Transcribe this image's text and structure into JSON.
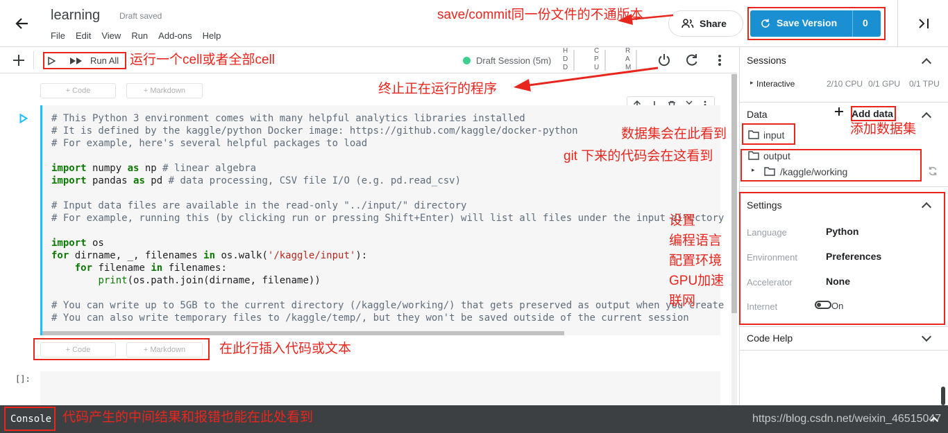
{
  "header": {
    "title": "learning",
    "status": "Draft saved",
    "menu": [
      "File",
      "Edit",
      "View",
      "Run",
      "Add-ons",
      "Help"
    ],
    "share_label": "Share",
    "save_label": "Save Version",
    "save_count": "0"
  },
  "toolbar": {
    "run_all": "Run All",
    "session": "Draft Session (5m)",
    "res1": "H\nD\nD",
    "res2": "C\nP\nU",
    "res3": "R\nA\nM"
  },
  "cells": {
    "add_code": "+ Code",
    "add_markdown": "+ Markdown",
    "prompt": "[]:"
  },
  "sidebar": {
    "sessions": {
      "title": "Sessions",
      "item": "Interactive",
      "cpu": "2/10 CPU",
      "gpu": "0/1 GPU",
      "tpu": "0/1 TPU"
    },
    "data": {
      "title": "Data",
      "add_data": "Add data",
      "input": "input",
      "output": "output",
      "working": "/kaggle/working"
    },
    "settings": {
      "title": "Settings",
      "rows": [
        {
          "label": "Language",
          "value": "Python"
        },
        {
          "label": "Environment",
          "value": "Preferences"
        },
        {
          "label": "Accelerator",
          "value": "None"
        },
        {
          "label": "Internet",
          "value": "On"
        }
      ]
    },
    "code_help": {
      "title": "Code Help"
    }
  },
  "console": {
    "label": "Console",
    "url": "https://blog.csdn.net/weixin_46515047"
  },
  "annotations": {
    "save": "save/commit同一份文件的不通版本",
    "run": "运行一个cell或者全部cell",
    "stop": "终止正在运行的程序",
    "dataset": "数据集会在此看到",
    "adddata": "添加数据集",
    "git": "git 下来的代码会在这看到",
    "settings": "设置\n编程语言\n配置环境\nGPU加速\n联网",
    "insert": "在此行插入代码或文本",
    "console": "代码产生的中间结果和报错也能在此处看到"
  },
  "colors": {
    "accent": "#20beff",
    "save_btn": "#1a8fd1",
    "annotation": "#e8261e"
  },
  "code_lines": [
    "# This Python 3 environment comes with many helpful analytics libraries installed",
    "# It is defined by the kaggle/python Docker image: https://github.com/kaggle/docker-python",
    "# For example, here's several helpful packages to load",
    "",
    "import numpy as np # linear algebra",
    "import pandas as pd # data processing, CSV file I/O (e.g. pd.read_csv)",
    "",
    "# Input data files are available in the read-only \"../input/\" directory",
    "# For example, running this (by clicking run or pressing Shift+Enter) will list all files under the input directory",
    "",
    "import os",
    "for dirname, _, filenames in os.walk('/kaggle/input'):",
    "    for filename in filenames:",
    "        print(os.path.join(dirname, filename))",
    "",
    "# You can write up to 5GB to the current directory (/kaggle/working/) that gets preserved as output when you create",
    "# You can also write temporary files to /kaggle/temp/, but they won't be saved outside of the current session"
  ]
}
